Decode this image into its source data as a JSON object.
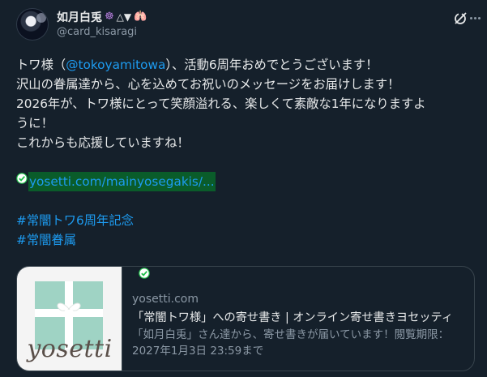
{
  "author": {
    "display_name": "如月白兎",
    "emoji_1": "☸",
    "emoji_2": "△▼",
    "emoji_3": "🫁",
    "handle": "@card_kisaragi"
  },
  "post": {
    "line1_before": "トワ様（",
    "mention": "@tokoyamitowa",
    "line1_after": "）、活動6周年おめでとうございます！",
    "line2": "沢山の眷属達から、心を込めてお祝いのメッセージをお届けします！",
    "line3": "2026年が、トワ様にとって笑顔溢れる、楽しくて素敵な1年になりますよ",
    "line4": "うに！",
    "line5": "これからも応援していますね！",
    "link": "yosetti.com/mainyosegakis/...",
    "hashtags": [
      "#常闇トワ6周年記念",
      "#常闇眷属"
    ]
  },
  "card": {
    "brand_text": "yosetti",
    "domain": "yosetti.com",
    "title": "「常闇トワ様」への寄せ書き | オンライン寄せ書きヨセッティ",
    "description": "「如月白兎」さん達から、寄せ書きが届いています！閲覧期限：2027年1月3日 23:59まで"
  },
  "colors": {
    "background": "#15202b",
    "text": "#e7e9ea",
    "secondary": "#8b98a5",
    "link": "#1d9bf0",
    "link_highlight": "#0a5c2a",
    "border": "#38444d",
    "check": "#1fbf4a",
    "gift_box": "#9fd3c4"
  },
  "icons": [
    "grok-icon",
    "more-icon",
    "check-icon"
  ]
}
